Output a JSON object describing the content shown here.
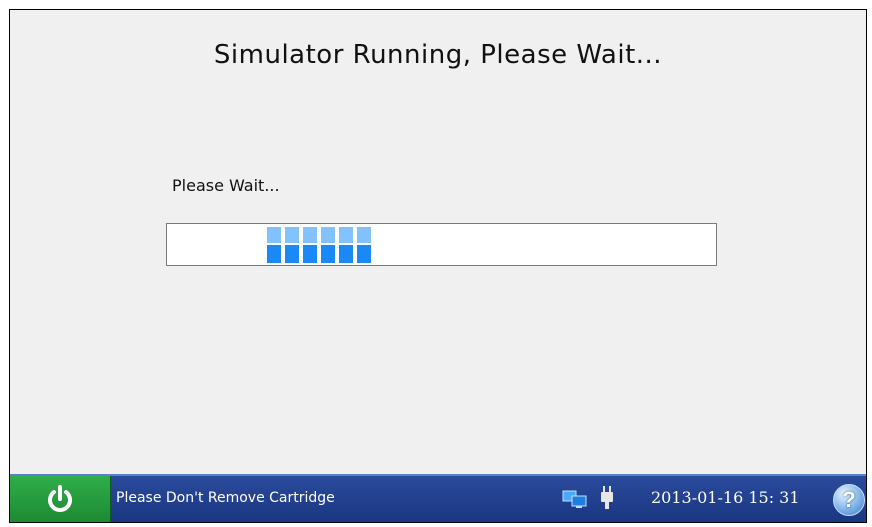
{
  "dialog": {
    "title": "Simulator Running, Please Wait...",
    "message": "Please Wait..."
  },
  "progress": {
    "style": "indeterminate-blocks",
    "block_count": 6,
    "colors": {
      "top": "#82c3ff",
      "bottom": "#1a88f5"
    }
  },
  "taskbar": {
    "power_icon": "power-icon",
    "power_color": "#2fae4a",
    "status": "Please Don't Remove Cartridge",
    "network_icon": "network-icon",
    "plug_icon": "power-plug-icon",
    "datetime": "2013-01-16  15: 31",
    "help_label": "?",
    "background": "#1a3782"
  }
}
